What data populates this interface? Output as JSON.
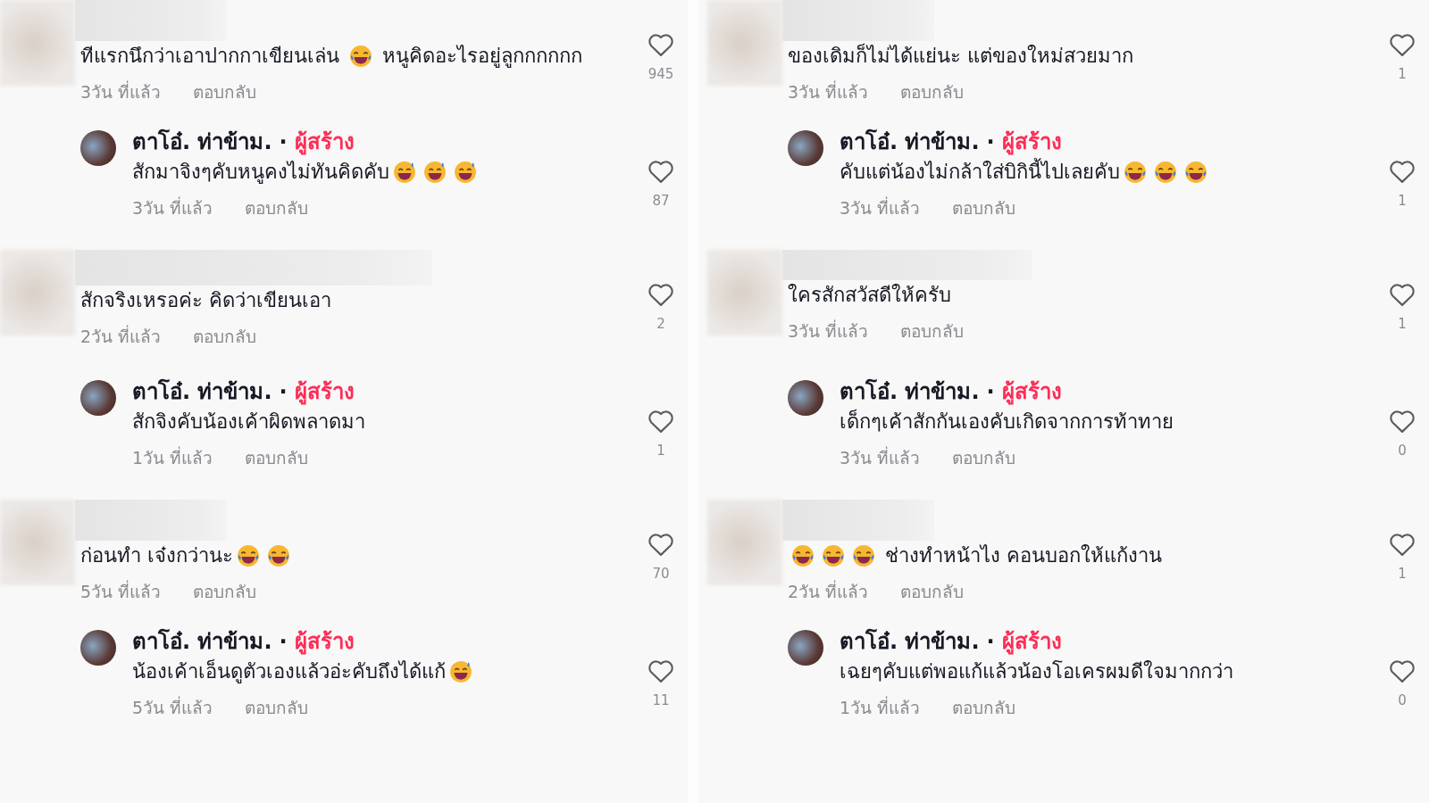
{
  "columns": [
    {
      "comments": [
        {
          "kind": "top",
          "segments": [
            {
              "kind": "text",
              "text": "ทีแรกนึกว่าเอาปากกาเขียนเล่น "
            },
            {
              "kind": "laugh"
            },
            {
              "kind": "text",
              "text": " หนูคิดอะไรอยู่ลูกกกกกก"
            }
          ],
          "time": "3วัน ที่แล้ว",
          "reply": "ตอบกลับ",
          "likes": "945"
        },
        {
          "kind": "reply",
          "author": "ตาโอ๋. ท่าข้าม.",
          "separator": "·",
          "badge": "ผู้สร้าง",
          "segments": [
            {
              "kind": "text",
              "text": "สักมาจิงๆคับหนูคงไม่ทันคิดคับ"
            },
            {
              "kind": "sweat"
            },
            {
              "kind": "sweat"
            },
            {
              "kind": "sweat"
            }
          ],
          "time": "3วัน ที่แล้ว",
          "reply": "ตอบกลับ",
          "likes": "87"
        },
        {
          "kind": "top",
          "segments": [
            {
              "kind": "text",
              "text": "สักจริงเหรอค่ะ คิดว่าเขียนเอา"
            }
          ],
          "time": "2วัน ที่แล้ว",
          "reply": "ตอบกลับ",
          "likes": "2"
        },
        {
          "kind": "reply",
          "author": "ตาโอ๋. ท่าข้าม.",
          "separator": "·",
          "badge": "ผู้สร้าง",
          "segments": [
            {
              "kind": "text",
              "text": "สักจิงคับน้องเค้าผิดพลาดมา"
            }
          ],
          "time": "1วัน ที่แล้ว",
          "reply": "ตอบกลับ",
          "likes": "1"
        },
        {
          "kind": "top",
          "segments": [
            {
              "kind": "text",
              "text": "ก่อนทำ เจ๋งกว่านะ"
            },
            {
              "kind": "laugh"
            },
            {
              "kind": "laugh"
            }
          ],
          "time": "5วัน ที่แล้ว",
          "reply": "ตอบกลับ",
          "likes": "70"
        },
        {
          "kind": "reply",
          "author": "ตาโอ๋. ท่าข้าม.",
          "separator": "·",
          "badge": "ผู้สร้าง",
          "segments": [
            {
              "kind": "text",
              "text": "น้องเค้าเอ็นดูตัวเองแล้วอ่ะคับถึงได้แก้"
            },
            {
              "kind": "sweat"
            }
          ],
          "time": "5วัน ที่แล้ว",
          "reply": "ตอบกลับ",
          "likes": "11"
        }
      ]
    },
    {
      "comments": [
        {
          "kind": "top",
          "segments": [
            {
              "kind": "text",
              "text": "ของเดิมก็ไม่ได้แย่นะ แต่ของใหม่สวยมาก"
            }
          ],
          "time": "3วัน ที่แล้ว",
          "reply": "ตอบกลับ",
          "likes": "1"
        },
        {
          "kind": "reply",
          "author": "ตาโอ๋. ท่าข้าม.",
          "separator": "·",
          "badge": "ผู้สร้าง",
          "segments": [
            {
              "kind": "text",
              "text": "คับแต่น้องไม่กล้าใส่บิกินี้ไปเลยคับ"
            },
            {
              "kind": "laugh"
            },
            {
              "kind": "laugh"
            },
            {
              "kind": "laugh"
            }
          ],
          "time": "3วัน ที่แล้ว",
          "reply": "ตอบกลับ",
          "likes": "1"
        },
        {
          "kind": "top",
          "segments": [
            {
              "kind": "text",
              "text": "ใครสักสวัสดีให้ครับ"
            }
          ],
          "time": "3วัน ที่แล้ว",
          "reply": "ตอบกลับ",
          "likes": "1"
        },
        {
          "kind": "reply",
          "author": "ตาโอ๋. ท่าข้าม.",
          "separator": "·",
          "badge": "ผู้สร้าง",
          "segments": [
            {
              "kind": "text",
              "text": "เด็กๆเค้าสักกันเองคับเกิดจากการท้าทาย"
            }
          ],
          "time": "3วัน ที่แล้ว",
          "reply": "ตอบกลับ",
          "likes": "0"
        },
        {
          "kind": "top",
          "segments": [
            {
              "kind": "laugh"
            },
            {
              "kind": "laugh"
            },
            {
              "kind": "laugh"
            },
            {
              "kind": "text",
              "text": " ช่างทำหน้าไง คอนบอกให้แก้งาน"
            }
          ],
          "time": "2วัน ที่แล้ว",
          "reply": "ตอบกลับ",
          "likes": "1"
        },
        {
          "kind": "reply",
          "author": "ตาโอ๋. ท่าข้าม.",
          "separator": "·",
          "badge": "ผู้สร้าง",
          "segments": [
            {
              "kind": "text",
              "text": "เฉยๆคับแต่พอแก้แล้วน้องโอเครผมดีใจมากกว่า"
            }
          ],
          "time": "1วัน ที่แล้ว",
          "reply": "ตอบกลับ",
          "likes": "0"
        }
      ]
    }
  ]
}
